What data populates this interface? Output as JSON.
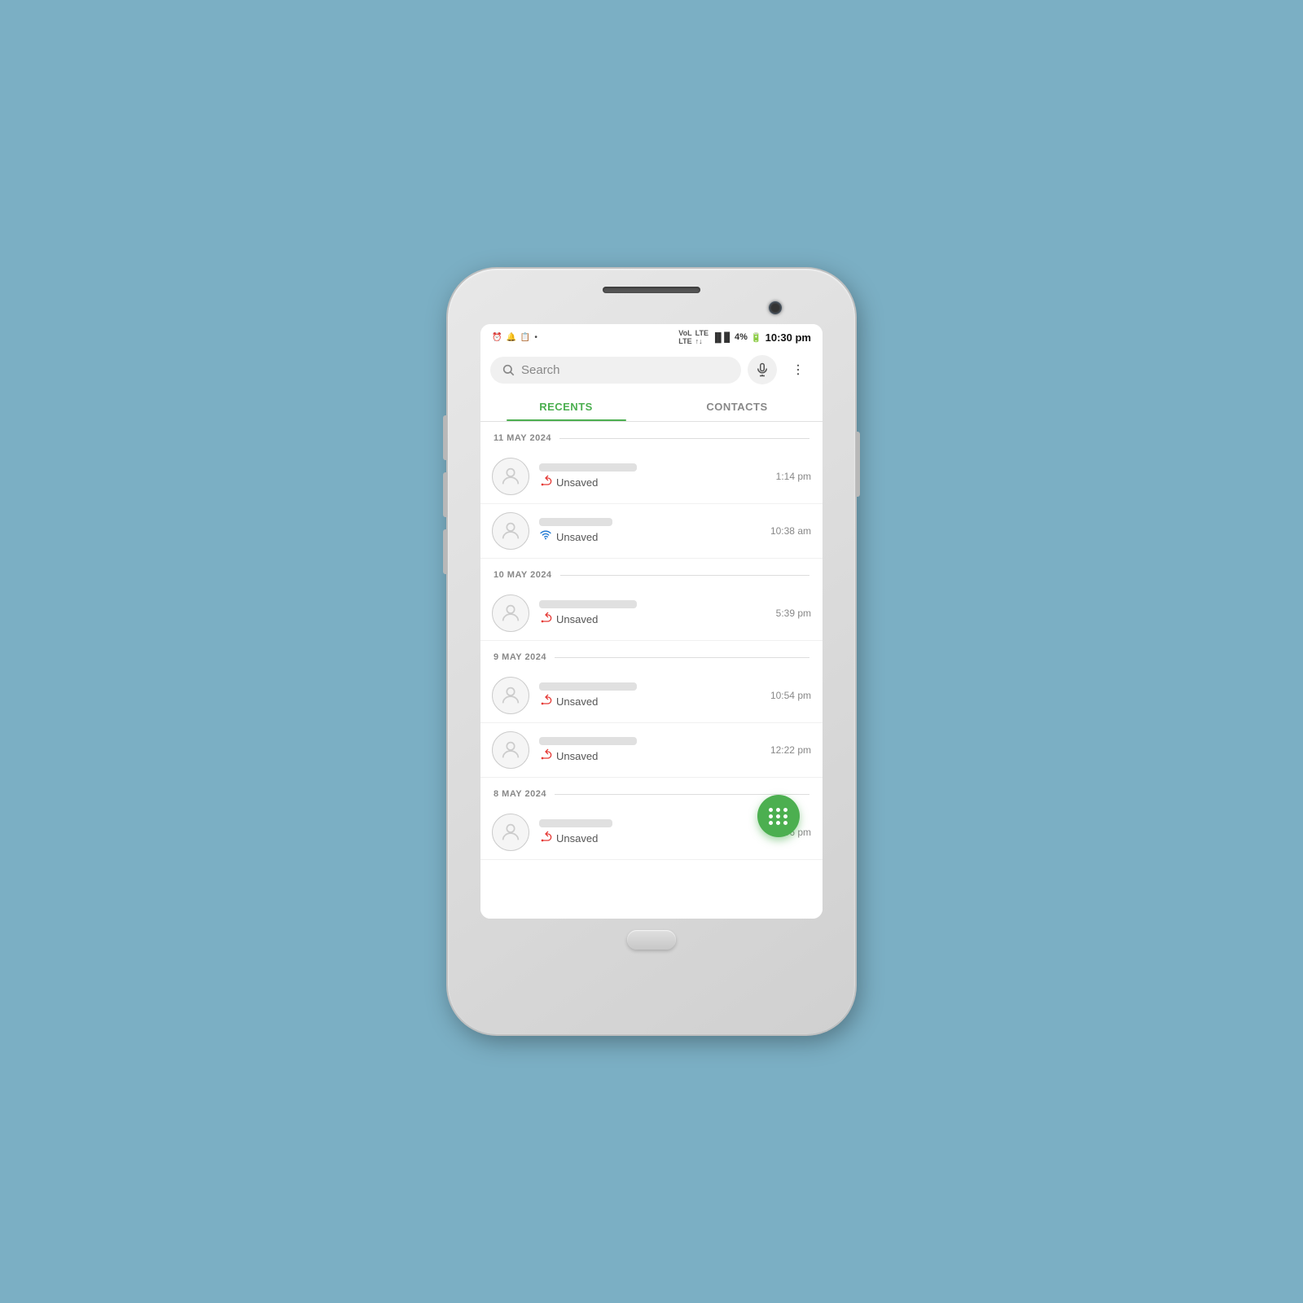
{
  "phone": {
    "status_bar": {
      "time": "10:30 pm",
      "battery": "4%",
      "signal_icons": "VoLTE LTE",
      "left_icons": [
        "alarm",
        "notification",
        "clipboard",
        "dot"
      ]
    },
    "search": {
      "placeholder": "Search"
    },
    "tabs": [
      {
        "id": "recents",
        "label": "RECENTS",
        "active": true
      },
      {
        "id": "contacts",
        "label": "CONTACTS",
        "active": false
      }
    ],
    "sections": [
      {
        "date": "11 MAY 2024",
        "calls": [
          {
            "type": "missed",
            "label": "Unsaved",
            "time": "1:14 pm"
          },
          {
            "type": "wifi",
            "label": "Unsaved",
            "time": "10:38 am"
          }
        ]
      },
      {
        "date": "10 MAY 2024",
        "calls": [
          {
            "type": "missed",
            "label": "Unsaved",
            "time": "5:39 pm"
          }
        ]
      },
      {
        "date": "9 MAY 2024",
        "calls": [
          {
            "type": "missed",
            "label": "Unsaved",
            "time": "10:54 pm"
          },
          {
            "type": "missed",
            "label": "Unsaved",
            "time": "12:22 pm"
          }
        ]
      },
      {
        "date": "8 MAY 2024",
        "calls": [
          {
            "type": "missed",
            "label": "Unsaved",
            "time": "1:06 pm"
          }
        ]
      }
    ],
    "fab_label": "dialpad",
    "colors": {
      "active_tab": "#4caf50",
      "missed_call": "#e53935",
      "wifi_call": "#1976d2",
      "fab": "#4caf50"
    }
  }
}
